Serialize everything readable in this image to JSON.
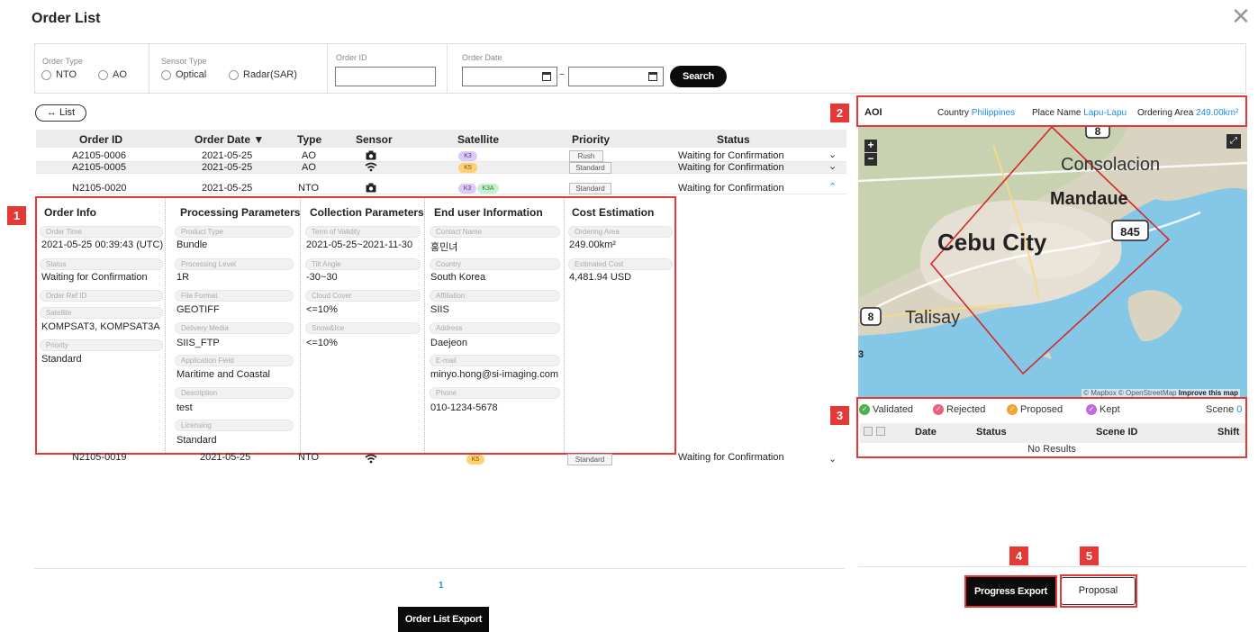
{
  "page_title": "Order List",
  "filters": {
    "order_type": {
      "label": "Order Type",
      "options": [
        "NTO",
        "AO"
      ]
    },
    "sensor_type": {
      "label": "Sensor Type",
      "options": [
        "Optical",
        "Radar(SAR)"
      ]
    },
    "order_id": {
      "label": "Order ID",
      "value": ""
    },
    "order_date": {
      "label": "Order Date",
      "separator": "~",
      "from": "",
      "to": ""
    },
    "search_label": "Search"
  },
  "list_button": "↔ List",
  "table": {
    "columns": [
      "Order ID",
      "Order Date ▼",
      "Type",
      "Sensor",
      "Satellite",
      "Priority",
      "Status"
    ],
    "rows": [
      {
        "order_id": "A2105-0006",
        "date": "2021-05-25",
        "type": "AO",
        "sensor": "camera-icon",
        "satellites": [
          "K3"
        ],
        "priority": "Rush",
        "status": "Waiting for Confirmation",
        "toggle": "⌄"
      },
      {
        "order_id": "A2105-0005",
        "date": "2021-05-25",
        "type": "AO",
        "sensor": "radar-icon",
        "satellites": [
          "K5"
        ],
        "priority": "Standard",
        "status": "Waiting for Confirmation",
        "toggle": "⌄"
      },
      {
        "order_id": "N2105-0020",
        "date": "2021-05-25",
        "type": "NTO",
        "sensor": "camera-icon",
        "satellites": [
          "K3",
          "K3A"
        ],
        "priority": "Standard",
        "status": "Waiting for Confirmation",
        "toggle": "⌃"
      },
      {
        "order_id": "N2105-0019",
        "date": "2021-05-25",
        "type": "NTO",
        "sensor": "radar-icon",
        "satellites": [
          "K5"
        ],
        "priority": "Standard",
        "status": "Waiting for Confirmation",
        "toggle": "⌄"
      }
    ]
  },
  "detail": {
    "order_info": {
      "title": "Order Info",
      "fields": [
        {
          "label": "Order Time",
          "value": "2021-05-25 00:39:43 (UTC)"
        },
        {
          "label": "Status",
          "value": "Waiting for Confirmation"
        },
        {
          "label": "Order Ref ID",
          "value": ""
        },
        {
          "label": "Satellite",
          "value": "KOMPSAT3, KOMPSAT3A"
        },
        {
          "label": "Priority",
          "value": "Standard"
        }
      ]
    },
    "processing": {
      "title": "Processing Parameters",
      "fields": [
        {
          "label": "Product Type",
          "value": "Bundle"
        },
        {
          "label": "Processing Level",
          "value": "1R"
        },
        {
          "label": "File Format",
          "value": "GEOTIFF"
        },
        {
          "label": "Delivery Media",
          "value": "SIIS_FTP"
        },
        {
          "label": "Application Field",
          "value": "Maritime and Coastal"
        },
        {
          "label": "Description",
          "value": "test"
        },
        {
          "label": "Licensing",
          "value": "Standard"
        }
      ]
    },
    "collection": {
      "title": "Collection Parameters",
      "fields": [
        {
          "label": "Term of Validity",
          "value": "2021-05-25~2021-11-30"
        },
        {
          "label": "Tilt Angle",
          "value": "-30~30"
        },
        {
          "label": "Cloud Cover",
          "value": "<=10%"
        },
        {
          "label": "Snow&Ice",
          "value": "<=10%"
        }
      ]
    },
    "end_user": {
      "title": "End user Information",
      "fields": [
        {
          "label": "Contact Name",
          "value": "홍민녀"
        },
        {
          "label": "Country",
          "value": "South Korea"
        },
        {
          "label": "Affiliation",
          "value": "SIIS"
        },
        {
          "label": "Address",
          "value": "Daejeon"
        },
        {
          "label": "E-mail",
          "value": "minyo.hong@si-imaging.com"
        },
        {
          "label": "Phone",
          "value": "010-1234-5678"
        }
      ]
    },
    "cost": {
      "title": "Cost Estimation",
      "fields": [
        {
          "label": "Ordering Area",
          "value": "249.00km²"
        },
        {
          "label": "Estimated Cost",
          "value": "4,481.94 USD"
        }
      ]
    }
  },
  "callouts": [
    "1",
    "2",
    "3",
    "4",
    "5"
  ],
  "aoi": {
    "title": "AOI",
    "country_label": "Country",
    "country": "Philippines",
    "place_label": "Place Name",
    "place": "Lapu-Lapu",
    "area_label": "Ordering Area",
    "area": "249.00km²"
  },
  "map": {
    "labels": [
      "Consolacion",
      "Mandaue",
      "Cebu City",
      "Talisay"
    ],
    "road_shields": [
      "845",
      "8",
      "8",
      "3"
    ],
    "zoom_in": "+",
    "zoom_out": "−",
    "attribution": "© Mapbox © OpenStreetMap",
    "attribution_bold": "Improve this map"
  },
  "scene": {
    "legend": [
      {
        "label": "Validated",
        "color": "#4caf50"
      },
      {
        "label": "Rejected",
        "color": "#ec5f7b"
      },
      {
        "label": "Proposed",
        "color": "#f4a233"
      },
      {
        "label": "Kept",
        "color": "#c26be0"
      }
    ],
    "scene_label": "Scene",
    "scene_count": "0",
    "columns": [
      "Date",
      "Status",
      "Scene ID",
      "Shift"
    ],
    "empty": "No Results"
  },
  "pagination": {
    "current": "1"
  },
  "buttons": {
    "order_list_export": "Order List Export",
    "progress_export": "Progress Export",
    "proposal": "Proposal"
  },
  "colors": {
    "accent_red": "#e53935",
    "link_blue": "#1a8fe0"
  }
}
